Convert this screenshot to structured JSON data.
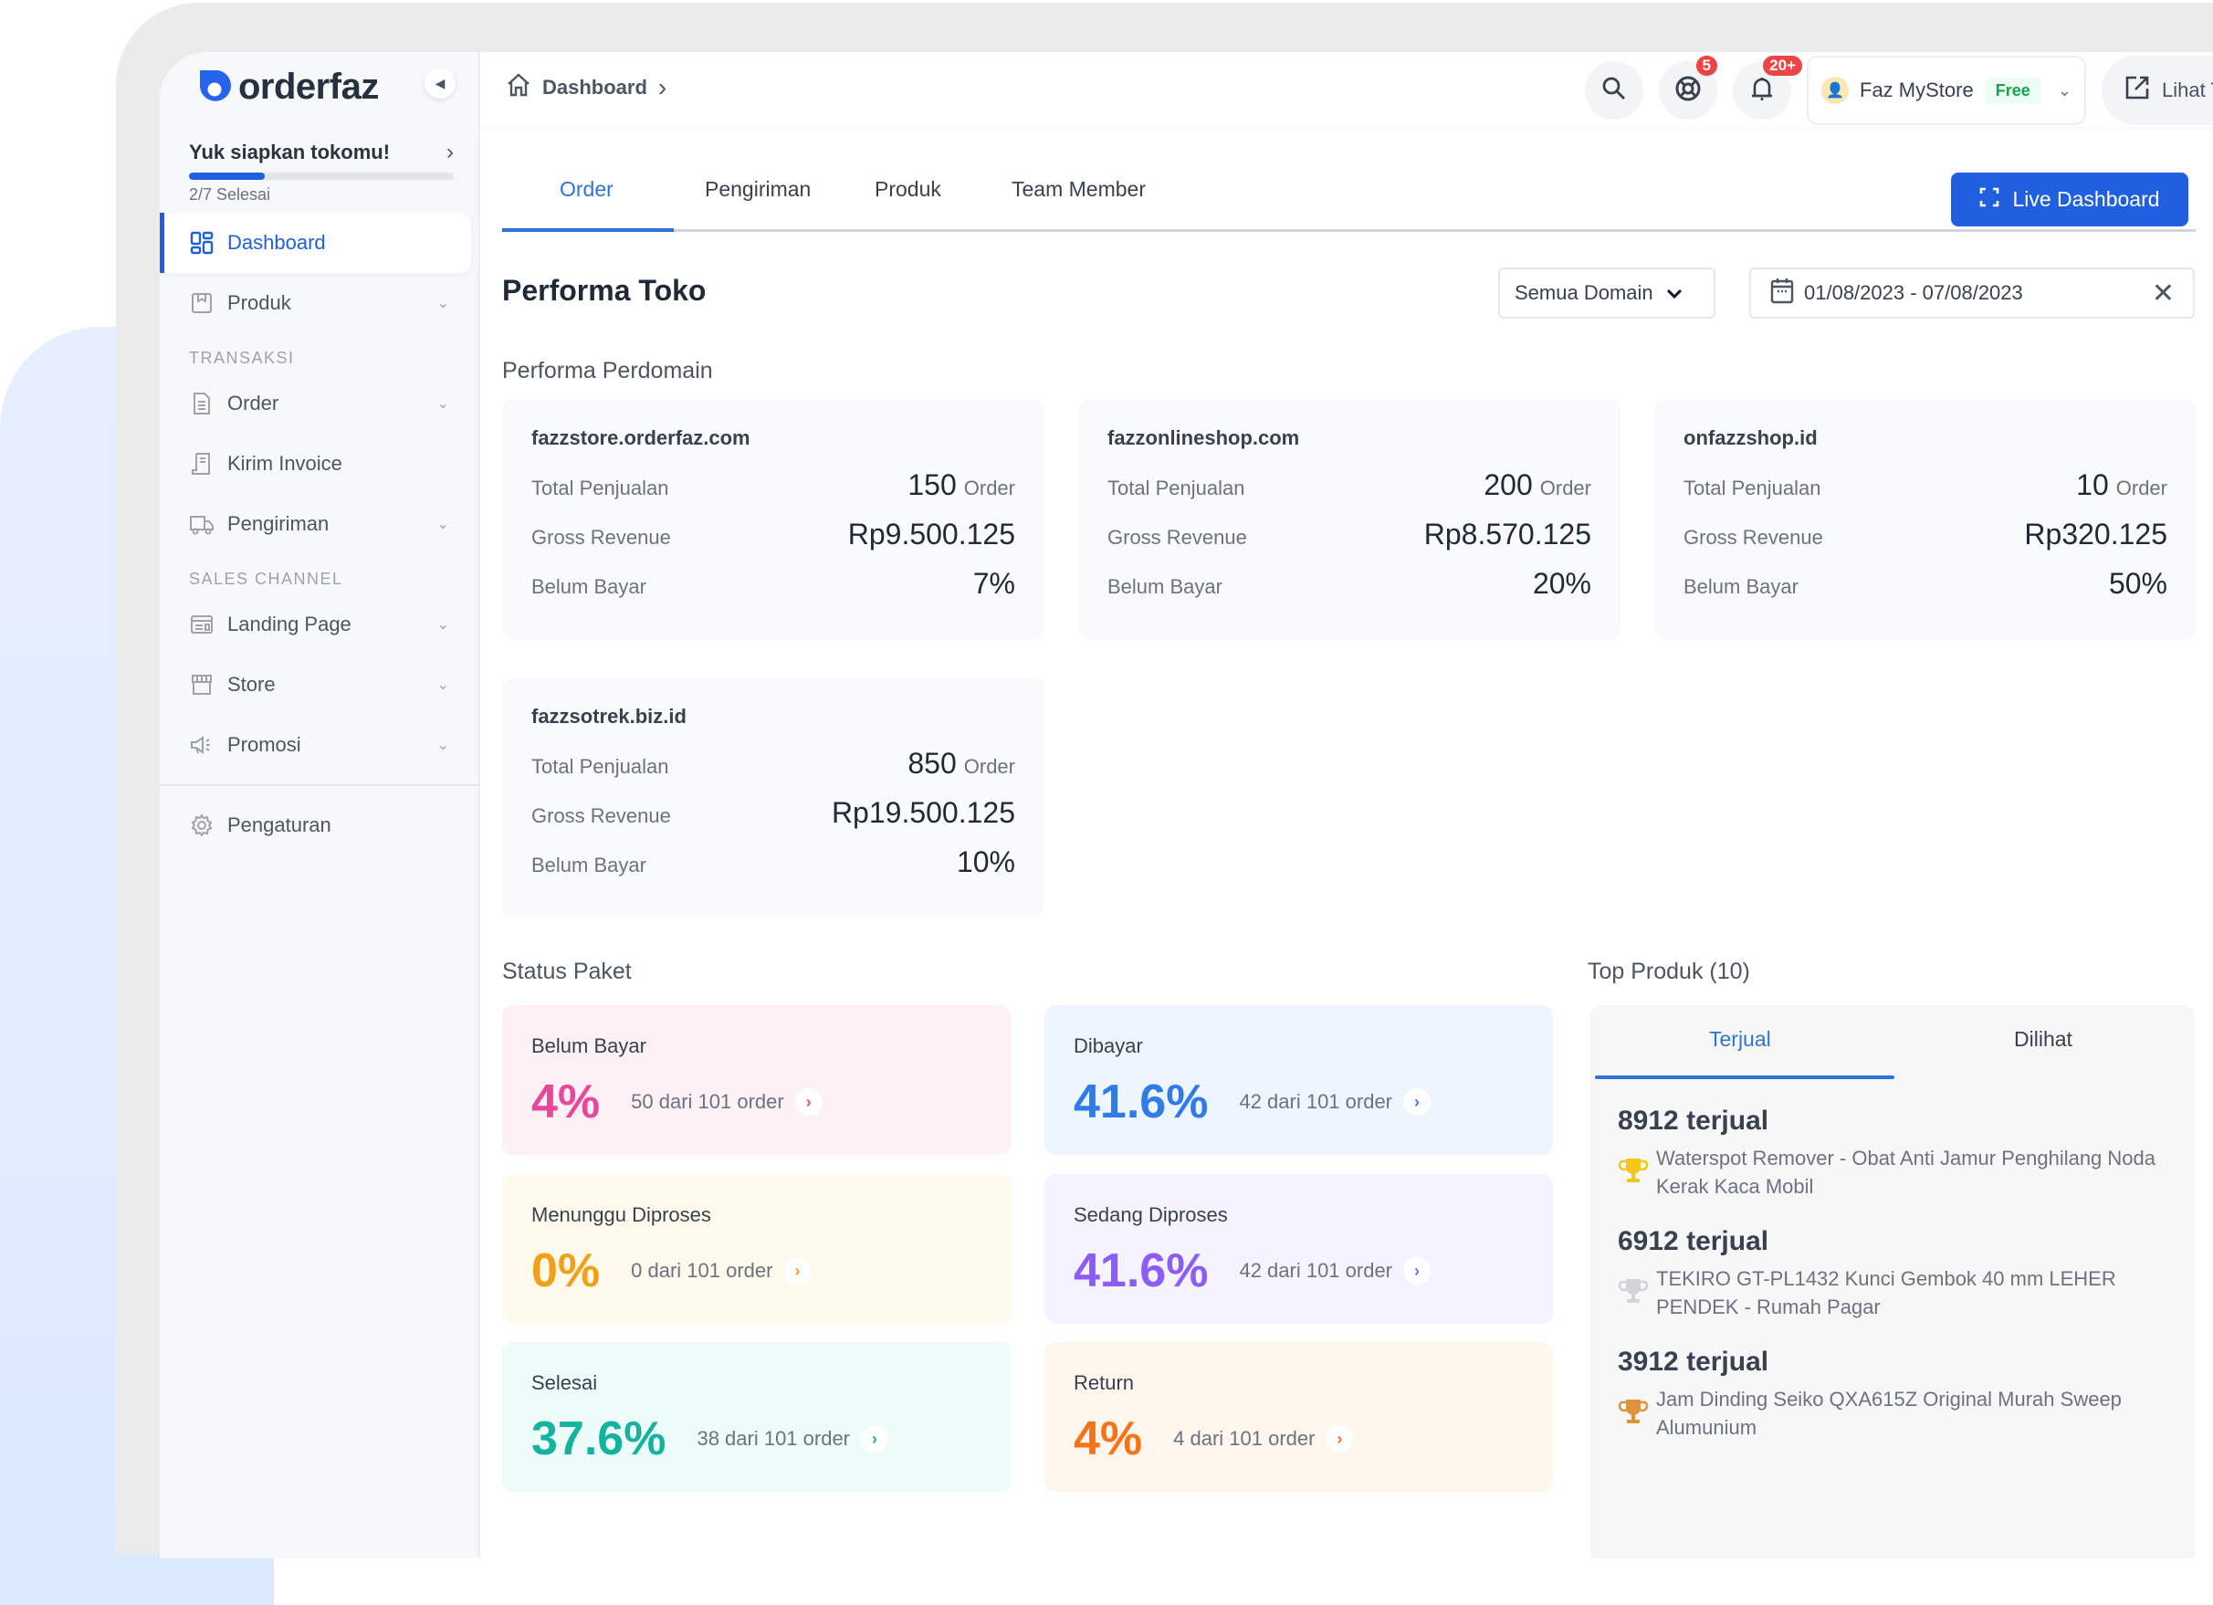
{
  "brand": {
    "name": "orderfaz",
    "accent": "#1f5fe0"
  },
  "setup": {
    "title": "Yuk siapkan tokomu!",
    "progress_text": "2/7 Selesai",
    "progress_done": 2,
    "progress_total": 7
  },
  "sidebar": {
    "items": [
      {
        "label": "Dashboard",
        "icon": "dashboard-icon",
        "active": true
      },
      {
        "label": "Produk",
        "icon": "product-icon",
        "expandable": true
      }
    ],
    "section_transaksi": "TRANSAKSI",
    "transaksi_items": [
      {
        "label": "Order",
        "icon": "document-icon",
        "expandable": true
      },
      {
        "label": "Kirim Invoice",
        "icon": "invoice-icon"
      },
      {
        "label": "Pengiriman",
        "icon": "truck-icon",
        "expandable": true
      }
    ],
    "section_sales": "SALES CHANNEL",
    "sales_items": [
      {
        "label": "Landing Page",
        "icon": "landing-page-icon",
        "expandable": true
      },
      {
        "label": "Store",
        "icon": "store-icon",
        "expandable": true
      },
      {
        "label": "Promosi",
        "icon": "megaphone-icon",
        "expandable": true
      }
    ],
    "settings": {
      "label": "Pengaturan",
      "icon": "gear-icon"
    }
  },
  "header": {
    "breadcrumb": "Dashboard",
    "help_badge": "5",
    "notif_badge": "20+",
    "store_name": "Faz MyStore",
    "store_plan": "Free",
    "lihat_toko": "Lihat Toko"
  },
  "tabs": [
    {
      "label": "Order",
      "active": true
    },
    {
      "label": "Pengiriman"
    },
    {
      "label": "Produk"
    },
    {
      "label": "Team Member"
    }
  ],
  "live_dashboard_label": "Live Dashboard",
  "page_title": "Performa Toko",
  "filters": {
    "domain": "Semua Domain",
    "date_range": "01/08/2023 - 07/08/2023"
  },
  "performa_perdomain": {
    "title": "Performa Perdomain",
    "labels": {
      "total": "Total Penjualan",
      "revenue": "Gross Revenue",
      "unpaid": "Belum Bayar",
      "unit": "Order"
    },
    "domains": [
      {
        "name": "fazzstore.orderfaz.com",
        "orders": "150",
        "revenue": "Rp9.500.125",
        "unpaid": "7%"
      },
      {
        "name": "fazzonlineshop.com",
        "orders": "200",
        "revenue": "Rp8.570.125",
        "unpaid": "20%"
      },
      {
        "name": "onfazzshop.id",
        "orders": "10",
        "revenue": "Rp320.125",
        "unpaid": "50%"
      },
      {
        "name": "fazzsotrek.biz.id",
        "orders": "850",
        "revenue": "Rp19.500.125",
        "unpaid": "10%"
      }
    ]
  },
  "status_paket": {
    "title": "Status Paket",
    "cards": [
      {
        "label": "Belum Bayar",
        "pct": "4%",
        "count": "50 dari 101 order",
        "color": "#e8479b",
        "bg": "#fdf1f6"
      },
      {
        "label": "Dibayar",
        "pct": "41.6%",
        "count": "42 dari 101 order",
        "color": "#2f7bea",
        "bg": "#edf5ff"
      },
      {
        "label": "Menunggu Diproses",
        "pct": "0%",
        "count": "0 dari 101 order",
        "color": "#f0a116",
        "bg": "#fffaeb"
      },
      {
        "label": "Sedang Diproses",
        "pct": "41.6%",
        "count": "42 dari 101 order",
        "color": "#8b5cf6",
        "bg": "#f4f3ff"
      },
      {
        "label": "Selesai",
        "pct": "37.6%",
        "count": "38 dari 101 order",
        "color": "#14b3a0",
        "bg": "#eefcf9"
      },
      {
        "label": "Return",
        "pct": "4%",
        "count": "4 dari 101 order",
        "color": "#f97316",
        "bg": "#fff6ed"
      }
    ]
  },
  "top_produk": {
    "title": "Top Produk (10)",
    "tabs": [
      {
        "label": "Terjual",
        "active": true
      },
      {
        "label": "Dilihat"
      }
    ],
    "items": [
      {
        "count": "8912 terjual",
        "name": "Waterspot Remover - Obat Anti Jamur Penghilang Noda Kerak Kaca Mobil",
        "trophy": "gold",
        "trophy_color": "#f5c518"
      },
      {
        "count": "6912 terjual",
        "name": "TEKIRO GT-PL1432 Kunci Gembok 40 mm LEHER PENDEK - Rumah Pagar",
        "trophy": "silver",
        "trophy_color": "#d4d4d8"
      },
      {
        "count": "3912 terjual",
        "name": "Jam Dinding Seiko QXA615Z Original Murah Sweep Alumunium",
        "trophy": "bronze",
        "trophy_color": "#e0913a"
      }
    ]
  }
}
